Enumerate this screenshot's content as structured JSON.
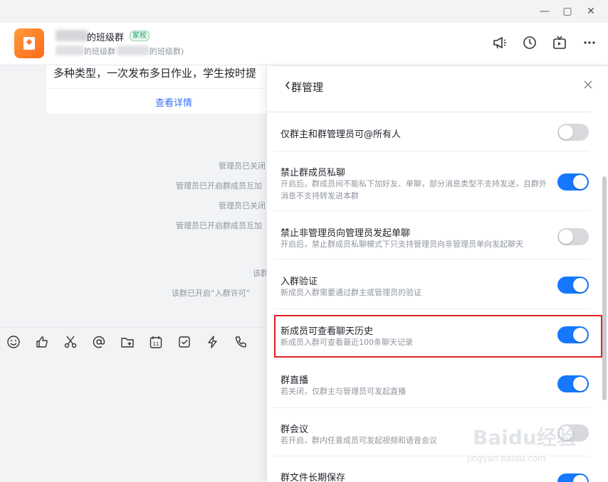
{
  "window": {
    "minimize": "—",
    "maximize": "▢",
    "close": "✕"
  },
  "header": {
    "group_name": "的班级群",
    "school_tag": "家校",
    "sub_left": "的班级群",
    "sub_right": "的班级群)"
  },
  "chat": {
    "card_text": "多种类型，一次发布多日作业，学生按时提",
    "card_link": "查看详情",
    "system_messages": [
      "管理员已关闭",
      "管理员已开启群成员互加",
      "管理员已关闭",
      "管理员已开启群成员互加",
      "该群",
      "该群已开启“入群许可”"
    ]
  },
  "panel": {
    "title": "群管理",
    "settings": [
      {
        "label": "仅群主和群管理员可@所有人",
        "desc": "",
        "on": false
      },
      {
        "label": "禁止群成员私聊",
        "desc": "开启后，群成员间不能私下加好友、单聊，部分消息类型不支持发送，且群外消息不支持转发进本群",
        "on": true
      },
      {
        "label": "禁止非管理员向管理员发起单聊",
        "desc": "开启后，禁止群成员私聊模式下只支持管理员向非管理员单向发起聊天",
        "on": false
      },
      {
        "label": "入群验证",
        "desc": "新成员入群需要通过群主或管理员的验证",
        "on": true
      },
      {
        "label": "新成员可查看聊天历史",
        "desc": "新成员入群可查看最近100条聊天记录",
        "on": true
      },
      {
        "label": "群直播",
        "desc": "若关闭，仅群主与管理员可发起直播",
        "on": true
      },
      {
        "label": "群会议",
        "desc": "若开启，群内任意成员可发起视频和语音会议",
        "on": false
      },
      {
        "label": "群文件长期保存",
        "desc": "",
        "on": true
      }
    ]
  },
  "watermark": {
    "brand": "Baidu经验",
    "url": "jingyan.baidu.com"
  },
  "colors": {
    "accent": "#1677ff",
    "highlight": "#e02020",
    "link": "#3370ff"
  }
}
